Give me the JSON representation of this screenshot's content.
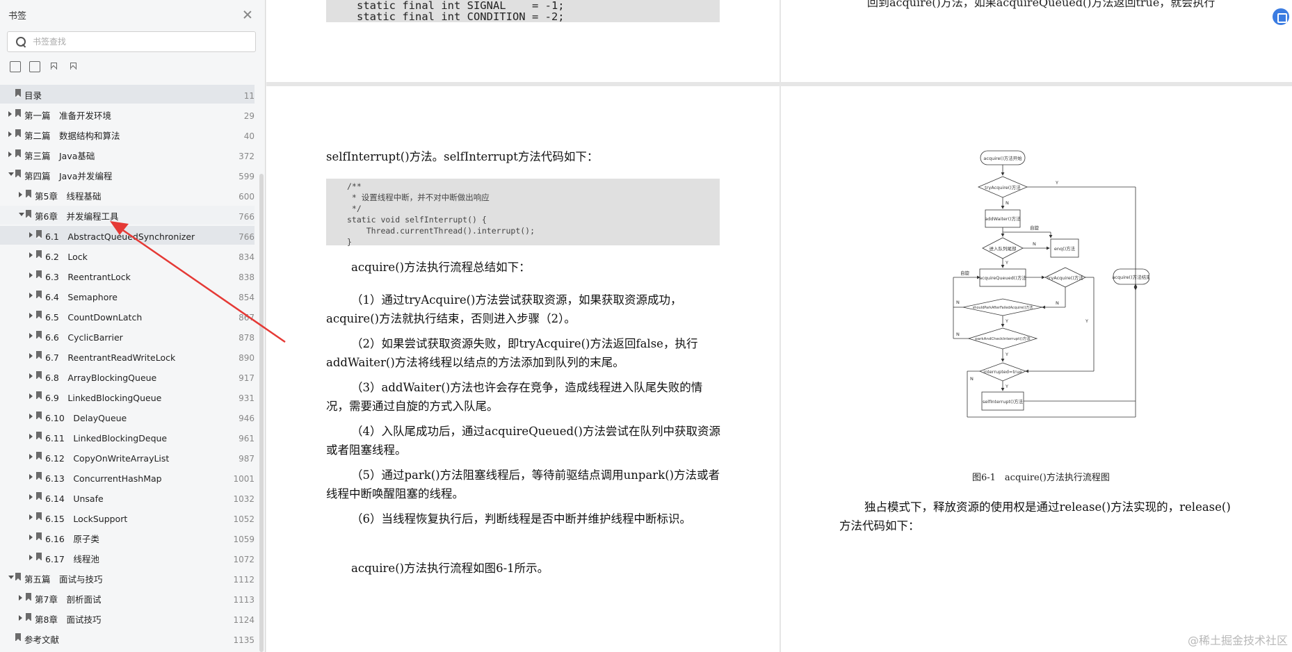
{
  "sidebar": {
    "title": "书签",
    "search_placeholder": "书签查找",
    "tools": [
      "expand-all-icon",
      "collapse-all-icon",
      "bookmark-icon",
      "bookmark-add-icon"
    ],
    "items": [
      {
        "label": "目录",
        "page": "11",
        "level": 0,
        "arrow": "none",
        "state": "selected"
      },
      {
        "label": "第一篇　准备开发环境",
        "page": "29",
        "level": 0,
        "arrow": "collapsed"
      },
      {
        "label": "第二篇　数据结构和算法",
        "page": "40",
        "level": 0,
        "arrow": "collapsed"
      },
      {
        "label": "第三篇　Java基础",
        "page": "372",
        "level": 0,
        "arrow": "collapsed"
      },
      {
        "label": "第四篇　Java并发编程",
        "page": "599",
        "level": 0,
        "arrow": "expanded"
      },
      {
        "label": "第5章　线程基础",
        "page": "600",
        "level": 1,
        "arrow": "collapsed"
      },
      {
        "label": "第6章　并发编程工具",
        "page": "766",
        "level": 1,
        "arrow": "expanded",
        "state": "hover"
      },
      {
        "label": "6.1　AbstractQueuedSynchronizer",
        "page": "766",
        "level": 2,
        "arrow": "collapsed",
        "state": "selected"
      },
      {
        "label": "6.2　Lock",
        "page": "834",
        "level": 2,
        "arrow": "collapsed"
      },
      {
        "label": "6.3　ReentrantLock",
        "page": "838",
        "level": 2,
        "arrow": "collapsed"
      },
      {
        "label": "6.4　Semaphore",
        "page": "854",
        "level": 2,
        "arrow": "collapsed"
      },
      {
        "label": "6.5　CountDownLatch",
        "page": "867",
        "level": 2,
        "arrow": "collapsed"
      },
      {
        "label": "6.6　CyclicBarrier",
        "page": "878",
        "level": 2,
        "arrow": "collapsed"
      },
      {
        "label": "6.7　ReentrantReadWriteLock",
        "page": "890",
        "level": 2,
        "arrow": "collapsed"
      },
      {
        "label": "6.8　ArrayBlockingQueue",
        "page": "917",
        "level": 2,
        "arrow": "collapsed"
      },
      {
        "label": "6.9　LinkedBlockingQueue",
        "page": "931",
        "level": 2,
        "arrow": "collapsed"
      },
      {
        "label": "6.10　DelayQueue",
        "page": "946",
        "level": 2,
        "arrow": "collapsed"
      },
      {
        "label": "6.11　LinkedBlockingDeque",
        "page": "961",
        "level": 2,
        "arrow": "collapsed"
      },
      {
        "label": "6.12　CopyOnWriteArrayList",
        "page": "987",
        "level": 2,
        "arrow": "collapsed"
      },
      {
        "label": "6.13　ConcurrentHashMap",
        "page": "1001",
        "level": 2,
        "arrow": "collapsed"
      },
      {
        "label": "6.14　Unsafe",
        "page": "1032",
        "level": 2,
        "arrow": "collapsed"
      },
      {
        "label": "6.15　LockSupport",
        "page": "1052",
        "level": 2,
        "arrow": "collapsed"
      },
      {
        "label": "6.16　原子类",
        "page": "1059",
        "level": 2,
        "arrow": "collapsed"
      },
      {
        "label": "6.17　线程池",
        "page": "1072",
        "level": 2,
        "arrow": "collapsed"
      },
      {
        "label": "第五篇　面试与技巧",
        "page": "1112",
        "level": 0,
        "arrow": "expanded"
      },
      {
        "label": "第7章　剖析面试",
        "page": "1113",
        "level": 1,
        "arrow": "collapsed"
      },
      {
        "label": "第8章　面试技巧",
        "page": "1124",
        "level": 1,
        "arrow": "collapsed"
      },
      {
        "label": "参考文献",
        "page": "1135",
        "level": 0,
        "arrow": "none"
      }
    ]
  },
  "page_top_left": {
    "code": "static final int SIGNAL    = -1;\nstatic final int CONDITION = -2;"
  },
  "page_top_right": {
    "text": "回到acquire()方法，如果acquireQueued()方法返回true，就会执行"
  },
  "page_left": {
    "intro": "selfInterrupt()方法。selfInterrupt方法代码如下：",
    "code": "/**\n * 设置线程中断，并不对中断做出响应\n */\nstatic void selfInterrupt() {\n    Thread.currentThread().interrupt();\n}",
    "summary_title": "acquire()方法执行流程总结如下：",
    "steps": [
      "（1）通过tryAcquire()方法尝试获取资源，如果获取资源成功，acquire()方法就执行结束，否则进入步骤（2）。",
      "（2）如果尝试获取资源失败，即tryAcquire()方法返回false，执行addWaiter()方法将线程以结点的方法添加到队列的末尾。",
      "（3）addWaiter()方法也许会存在竞争，造成线程进入队尾失败的情况，需要通过自旋的方式入队尾。",
      "（4）入队尾成功后，通过acquireQueued()方法尝试在队列中获取资源或者阻塞线程。",
      "（5）通过park()方法阻塞线程后，等待前驱结点调用unpark()方法或者线程中断唤醒阻塞的线程。",
      "（6）当线程恢复执行后，判断线程是否中断并维护线程中断标识。"
    ],
    "closing": "acquire()方法执行流程如图6-1所示。"
  },
  "page_right": {
    "flow": {
      "start": "acquire()方法开始",
      "try1": "tryAcquire()方法",
      "addWaiter": "addWaiter()方法",
      "spin": "自旋",
      "enterQueue": "进入队列尾部",
      "enq": "enq()方法",
      "acquireQueued": "acquireQueued()方法",
      "try2": "tryAcquire()方法",
      "end": "acquire()方法结束",
      "shouldPark": "shouldParkAfterFailedAcquire()方法",
      "parkCheck": "parkAndCheckInterrupt()方法",
      "interrupted": "interrupted=true",
      "selfInterrupt": "selfInterrupt()方法",
      "y": "Y",
      "n": "N"
    },
    "caption": "图6-1　acquire()方法执行流程图",
    "para": "独占模式下，释放资源的使用权是通过release()方法实现的，release()方法代码如下："
  },
  "watermark": "@稀土掘金技术社区"
}
